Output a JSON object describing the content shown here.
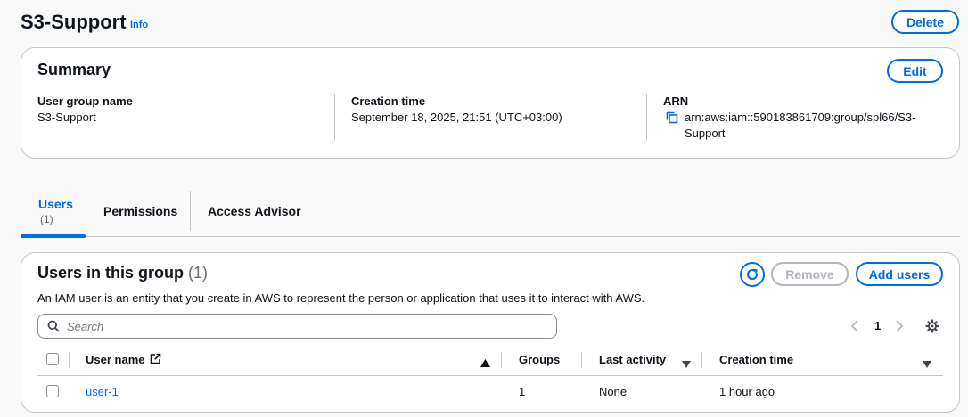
{
  "header": {
    "title": "S3-Support",
    "info_link": "Info",
    "delete_label": "Delete"
  },
  "summary": {
    "title": "Summary",
    "edit_label": "Edit",
    "group_name_label": "User group name",
    "group_name_value": "S3-Support",
    "creation_time_label": "Creation time",
    "creation_time_value": "September 18, 2025, 21:51 (UTC+03:00)",
    "arn_label": "ARN",
    "arn_line1": "arn:aws:iam::590183861709:group/spl66/S3-",
    "arn_line2": "Support"
  },
  "tabs": [
    {
      "label": "Users",
      "count": "(1)",
      "active": true
    },
    {
      "label": "Permissions"
    },
    {
      "label": "Access Advisor"
    }
  ],
  "users_panel": {
    "title": "Users in this group",
    "count": "(1)",
    "description": "An IAM user is an entity that you create in AWS to represent the person or application that uses it to interact with AWS.",
    "remove_label": "Remove",
    "add_label": "Add users",
    "search_placeholder": "Search",
    "page_number": "1",
    "columns": {
      "user_name": "User name",
      "groups": "Groups",
      "last_activity": "Last activity",
      "creation_time": "Creation time"
    },
    "rows": [
      {
        "user_name": "user-1",
        "groups": "1",
        "last_activity": "None",
        "creation_time": "1 hour ago"
      }
    ]
  },
  "colors": {
    "accent": "#006ce0",
    "border": "#c6c6cd",
    "text": "#0f141a",
    "disabled": "#b4b4bb"
  }
}
